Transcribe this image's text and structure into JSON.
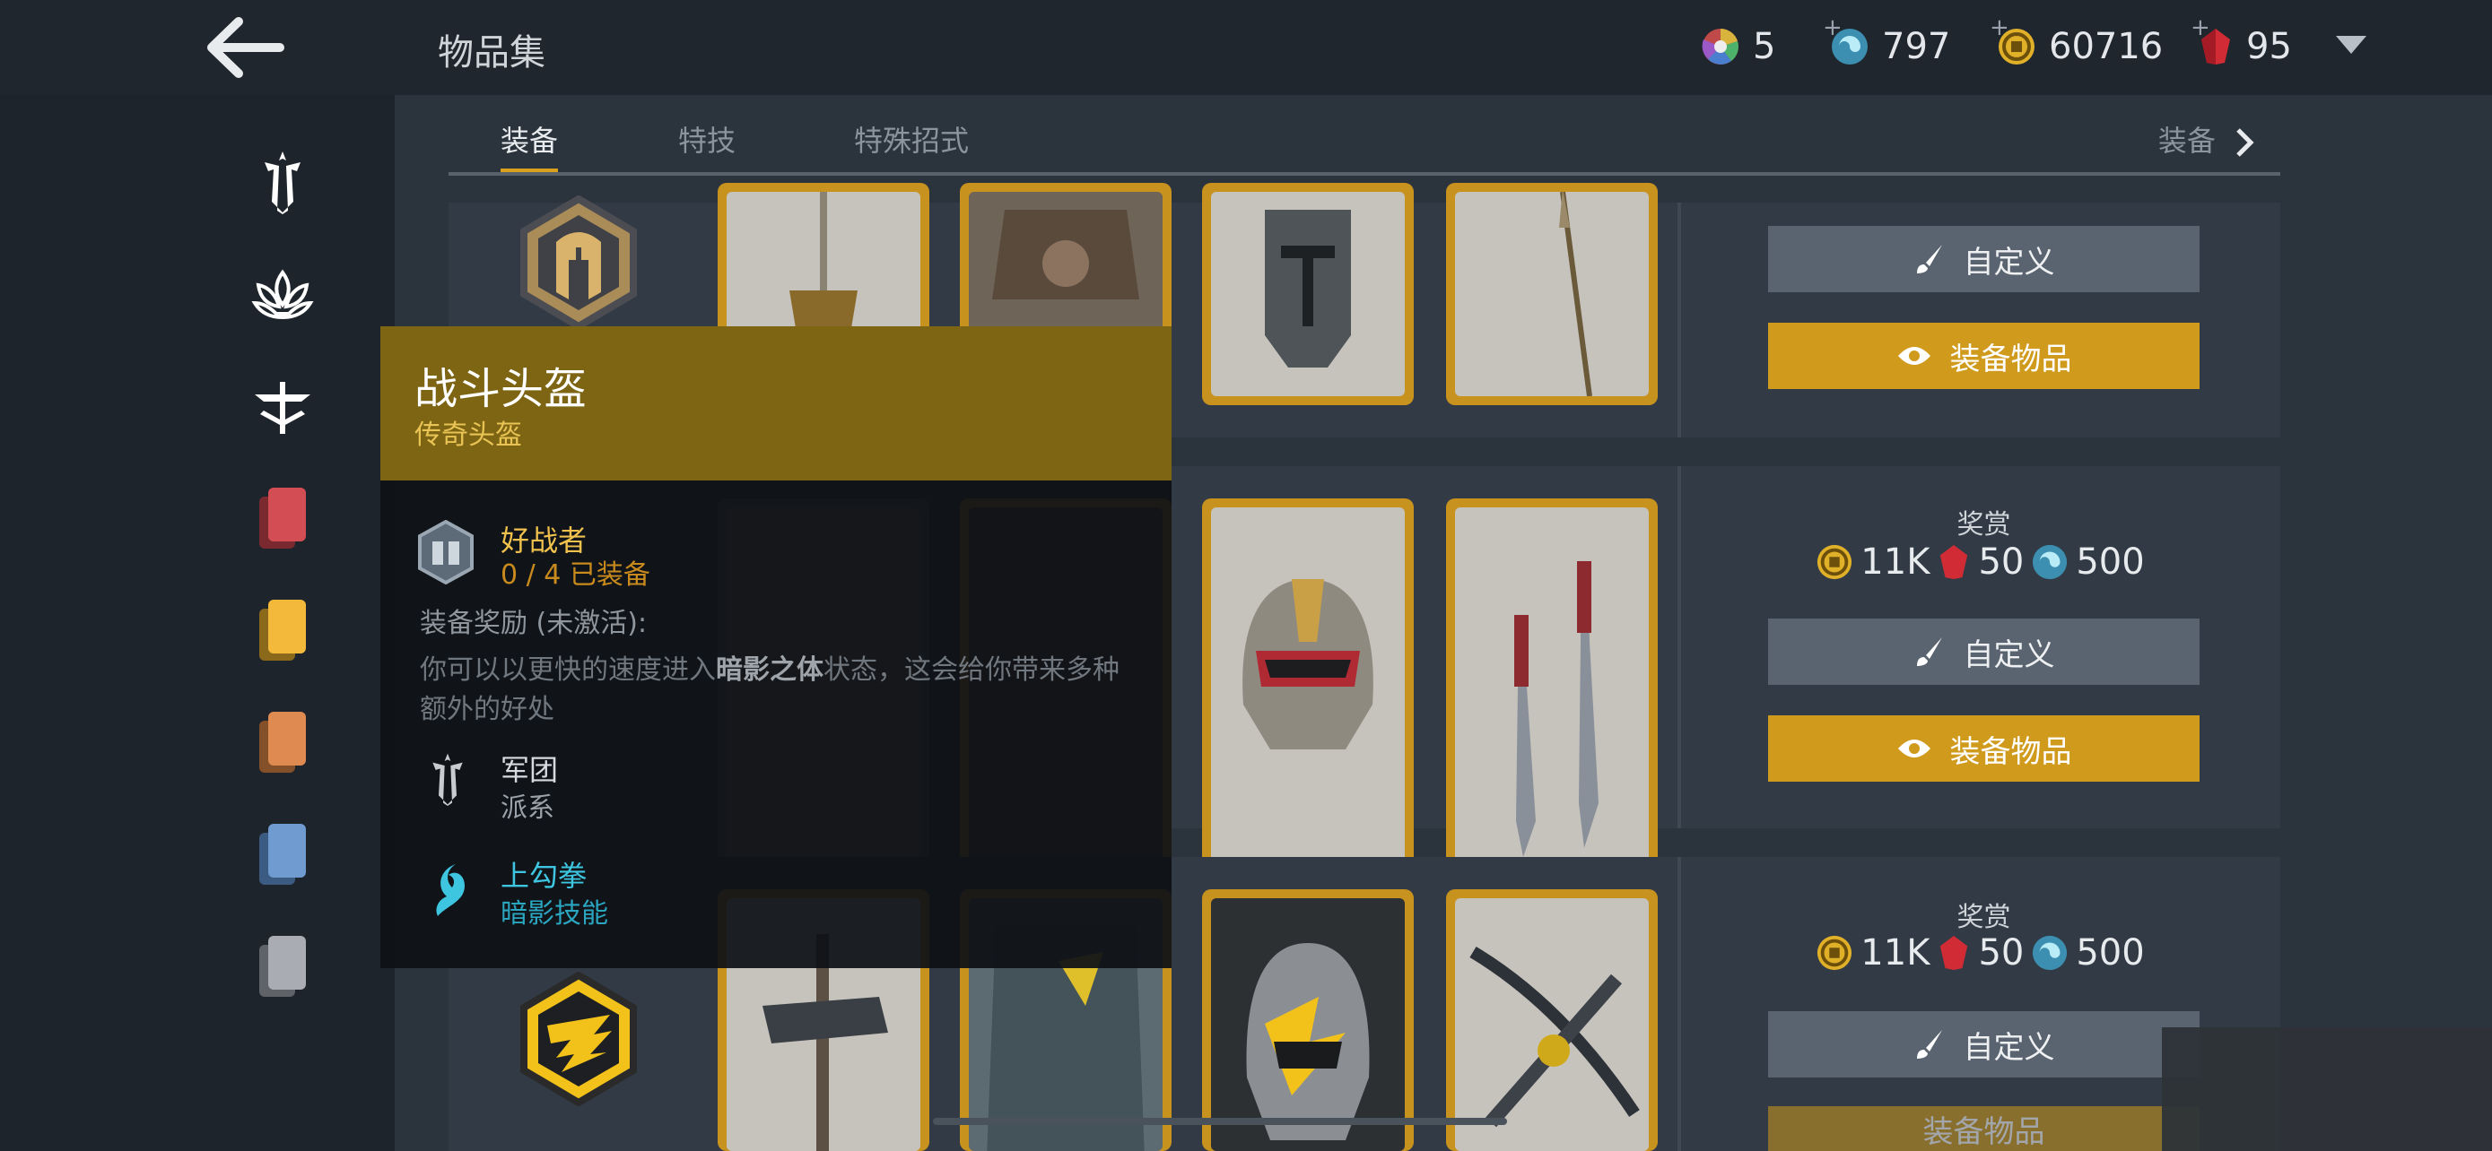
{
  "header": {
    "title": "物品集"
  },
  "currencies": [
    {
      "icon": "color-wheel-icon",
      "value": "5"
    },
    {
      "icon": "swirl-orb-icon",
      "value": "797"
    },
    {
      "icon": "gold-coin-icon",
      "value": "60716"
    },
    {
      "icon": "red-gem-icon",
      "value": "95"
    }
  ],
  "tabs": [
    "装备",
    "特技",
    "特殊招式"
  ],
  "tab_right": "装备",
  "rows": [
    {
      "buttons": {
        "customize": "自定义",
        "equip": "装备物品"
      }
    },
    {
      "reward_title": "奖赏",
      "reward": {
        "coins": "11K",
        "gems": "50",
        "orbs": "500"
      },
      "buttons": {
        "customize": "自定义",
        "equip": "装备物品"
      }
    },
    {
      "reward_title": "奖赏",
      "reward": {
        "coins": "11K",
        "gems": "50",
        "orbs": "500"
      },
      "buttons": {
        "customize": "自定义",
        "equip": "装备物品"
      }
    }
  ],
  "tooltip": {
    "name": "战斗头盔",
    "rarity": "传奇头盔",
    "set_name": "好战者",
    "set_progress": "0 / 4 已装备",
    "bonus_title": "装备奖励 (未激活):",
    "bonus_desc_1": "你可以以更快的速度进入",
    "bonus_keyword": "暗影之体",
    "bonus_desc_2": "状态，这会给你带来多种",
    "bonus_desc_3": "额外的好处",
    "faction_name": "军团",
    "faction_type": "派系",
    "skill_name": "上勾拳",
    "skill_type": "暗影技能"
  },
  "colors": {
    "gold": "#d09a1c",
    "accent_teal": "#3ec6e0",
    "rarity_gold": "#e9c455"
  }
}
